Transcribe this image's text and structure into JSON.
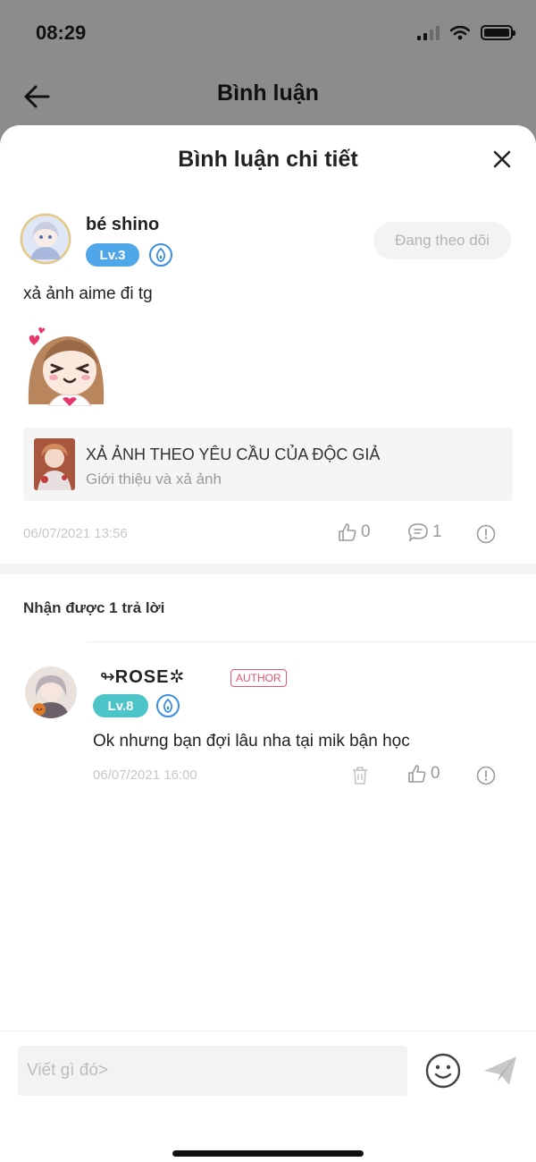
{
  "status": {
    "time": "08:29"
  },
  "background_header": {
    "title": "Bình luận"
  },
  "sheet": {
    "title": "Bình luận chi tiết"
  },
  "comment": {
    "author": "bé shino",
    "level": "Lv.3",
    "follow_label": "Đang theo dõi",
    "text": "xả ảnh aime đi tg",
    "reference": {
      "title": "XẢ ẢNH THEO YÊU CẦU CỦA ĐỘC GIẢ",
      "subtitle": "Giới thiệu và xả ảnh"
    },
    "timestamp": "06/07/2021 13:56",
    "likes": "0",
    "replies": "1"
  },
  "replies_header": "Nhận được 1 trả lời",
  "reply": {
    "author": "ROSE",
    "author_tag": "AUTHOR",
    "level": "Lv.8",
    "text": "Ok nhưng bạn đợi lâu nha tại mik bận học",
    "timestamp": "06/07/2021 16:00",
    "likes": "0"
  },
  "composer": {
    "placeholder": "Viết gì đó>"
  },
  "colors": {
    "lv3": "#4fa7ea",
    "lv8": "#4cc4c8",
    "author_tag": "#e2566f",
    "badge_blue": "#3b8ee0"
  }
}
